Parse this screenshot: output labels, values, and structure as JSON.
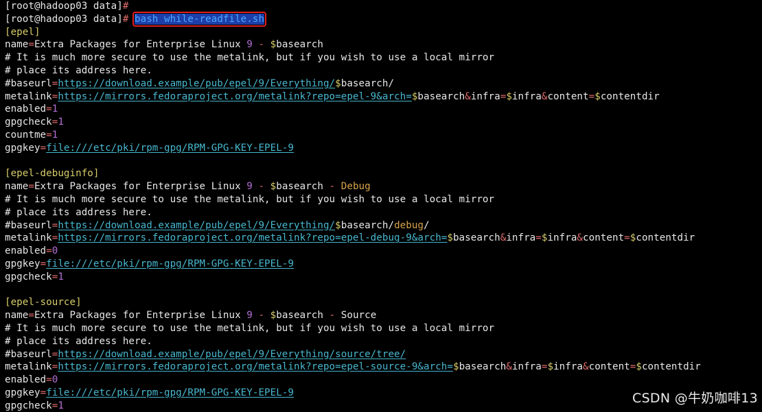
{
  "terminal": {
    "lines": [
      [
        {
          "t": "[root@hadoop03 data]",
          "c": "text"
        },
        {
          "t": "#",
          "c": "prompt-hash"
        }
      ],
      [
        {
          "t": "[root@hadoop03 data]",
          "c": "text"
        },
        {
          "t": "# ",
          "c": "prompt-hash"
        },
        {
          "t": "bash while-readfile.sh",
          "c": "cmd",
          "box": true
        }
      ],
      [
        {
          "t": "[epel]",
          "c": "sect"
        }
      ],
      [
        {
          "t": "name",
          "c": "text"
        },
        {
          "t": "=",
          "c": "op"
        },
        {
          "t": "Extra Packages for Enterprise Linux ",
          "c": "text"
        },
        {
          "t": "9",
          "c": "num"
        },
        {
          "t": " - ",
          "c": "op"
        },
        {
          "t": "$",
          "c": "dollar"
        },
        {
          "t": "basearch",
          "c": "text"
        }
      ],
      [
        {
          "t": "# It is much more secure to use the metalink, but if you wish to use a local mirror",
          "c": "text"
        }
      ],
      [
        {
          "t": "# place its address here.",
          "c": "text"
        }
      ],
      [
        {
          "t": "#baseurl",
          "c": "text"
        },
        {
          "t": "=",
          "c": "op"
        },
        {
          "t": "https://download.example/pub/epel/9/Everything/",
          "c": "link"
        },
        {
          "t": "$",
          "c": "dollar"
        },
        {
          "t": "basearch/",
          "c": "text"
        }
      ],
      [
        {
          "t": "metalink",
          "c": "text"
        },
        {
          "t": "=",
          "c": "op"
        },
        {
          "t": "https://mirrors.fedoraproject.org/metalink?repo=epel-9&arch=",
          "c": "link"
        },
        {
          "t": "$",
          "c": "dollar"
        },
        {
          "t": "basearch",
          "c": "text"
        },
        {
          "t": "&",
          "c": "op"
        },
        {
          "t": "infra",
          "c": "text"
        },
        {
          "t": "=",
          "c": "op"
        },
        {
          "t": "$",
          "c": "dollar"
        },
        {
          "t": "infra",
          "c": "text"
        },
        {
          "t": "&",
          "c": "op"
        },
        {
          "t": "content",
          "c": "text"
        },
        {
          "t": "=",
          "c": "op"
        },
        {
          "t": "$",
          "c": "dollar"
        },
        {
          "t": "contentdir",
          "c": "text"
        }
      ],
      [
        {
          "t": "enabled",
          "c": "text"
        },
        {
          "t": "=",
          "c": "op"
        },
        {
          "t": "1",
          "c": "num"
        }
      ],
      [
        {
          "t": "gpgcheck",
          "c": "text"
        },
        {
          "t": "=",
          "c": "op"
        },
        {
          "t": "1",
          "c": "num"
        }
      ],
      [
        {
          "t": "countme",
          "c": "text"
        },
        {
          "t": "=",
          "c": "op"
        },
        {
          "t": "1",
          "c": "num"
        }
      ],
      [
        {
          "t": "gpgkey",
          "c": "text"
        },
        {
          "t": "=",
          "c": "op"
        },
        {
          "t": "file:///etc/pki/rpm-gpg/RPM-GPG-KEY-EPEL-9",
          "c": "link"
        }
      ],
      [],
      [
        {
          "t": "[epel-debuginfo]",
          "c": "sect"
        }
      ],
      [
        {
          "t": "name",
          "c": "text"
        },
        {
          "t": "=",
          "c": "op"
        },
        {
          "t": "Extra Packages for Enterprise Linux ",
          "c": "text"
        },
        {
          "t": "9",
          "c": "num"
        },
        {
          "t": " - ",
          "c": "op"
        },
        {
          "t": "$",
          "c": "dollar"
        },
        {
          "t": "basearch",
          "c": "text"
        },
        {
          "t": " - ",
          "c": "op"
        },
        {
          "t": "Debug",
          "c": "kw"
        }
      ],
      [
        {
          "t": "# It is much more secure to use the metalink, but if you wish to use a local mirror",
          "c": "text"
        }
      ],
      [
        {
          "t": "# place its address here.",
          "c": "text"
        }
      ],
      [
        {
          "t": "#baseurl",
          "c": "text"
        },
        {
          "t": "=",
          "c": "op"
        },
        {
          "t": "https://download.example/pub/epel/9/Everything/",
          "c": "link"
        },
        {
          "t": "$",
          "c": "dollar"
        },
        {
          "t": "basearch/",
          "c": "text"
        },
        {
          "t": "debug",
          "c": "kw"
        },
        {
          "t": "/",
          "c": "text"
        }
      ],
      [
        {
          "t": "metalink",
          "c": "text"
        },
        {
          "t": "=",
          "c": "op"
        },
        {
          "t": "https://mirrors.fedoraproject.org/metalink?repo=epel-debug-9&arch=",
          "c": "link"
        },
        {
          "t": "$",
          "c": "dollar"
        },
        {
          "t": "basearch",
          "c": "text"
        },
        {
          "t": "&",
          "c": "op"
        },
        {
          "t": "infra",
          "c": "text"
        },
        {
          "t": "=",
          "c": "op"
        },
        {
          "t": "$",
          "c": "dollar"
        },
        {
          "t": "infra",
          "c": "text"
        },
        {
          "t": "&",
          "c": "op"
        },
        {
          "t": "content",
          "c": "text"
        },
        {
          "t": "=",
          "c": "op"
        },
        {
          "t": "$",
          "c": "dollar"
        },
        {
          "t": "contentdir",
          "c": "text"
        }
      ],
      [
        {
          "t": "enabled",
          "c": "text"
        },
        {
          "t": "=",
          "c": "op"
        },
        {
          "t": "0",
          "c": "num"
        }
      ],
      [
        {
          "t": "gpgkey",
          "c": "text"
        },
        {
          "t": "=",
          "c": "op"
        },
        {
          "t": "file:///etc/pki/rpm-gpg/RPM-GPG-KEY-EPEL-9",
          "c": "link"
        }
      ],
      [
        {
          "t": "gpgcheck",
          "c": "text"
        },
        {
          "t": "=",
          "c": "op"
        },
        {
          "t": "1",
          "c": "num"
        }
      ],
      [],
      [
        {
          "t": "[epel-source]",
          "c": "sect"
        }
      ],
      [
        {
          "t": "name",
          "c": "text"
        },
        {
          "t": "=",
          "c": "op"
        },
        {
          "t": "Extra Packages for Enterprise Linux ",
          "c": "text"
        },
        {
          "t": "9",
          "c": "num"
        },
        {
          "t": " - ",
          "c": "op"
        },
        {
          "t": "$",
          "c": "dollar"
        },
        {
          "t": "basearch",
          "c": "text"
        },
        {
          "t": " - ",
          "c": "op"
        },
        {
          "t": "Source",
          "c": "text"
        }
      ],
      [
        {
          "t": "# It is much more secure to use the metalink, but if you wish to use a local mirror",
          "c": "text"
        }
      ],
      [
        {
          "t": "# place its address here.",
          "c": "text"
        }
      ],
      [
        {
          "t": "#baseurl",
          "c": "text"
        },
        {
          "t": "=",
          "c": "op"
        },
        {
          "t": "https://download.example/pub/epel/9/Everything/source/tree/",
          "c": "link"
        }
      ],
      [
        {
          "t": "metalink",
          "c": "text"
        },
        {
          "t": "=",
          "c": "op"
        },
        {
          "t": "https://mirrors.fedoraproject.org/metalink?repo=epel-source-9&arch=",
          "c": "link"
        },
        {
          "t": "$",
          "c": "dollar"
        },
        {
          "t": "basearch",
          "c": "text"
        },
        {
          "t": "&",
          "c": "op"
        },
        {
          "t": "infra",
          "c": "text"
        },
        {
          "t": "=",
          "c": "op"
        },
        {
          "t": "$",
          "c": "dollar"
        },
        {
          "t": "infra",
          "c": "text"
        },
        {
          "t": "&",
          "c": "op"
        },
        {
          "t": "content",
          "c": "text"
        },
        {
          "t": "=",
          "c": "op"
        },
        {
          "t": "$",
          "c": "dollar"
        },
        {
          "t": "contentdir",
          "c": "text"
        }
      ],
      [
        {
          "t": "enabled",
          "c": "text"
        },
        {
          "t": "=",
          "c": "op"
        },
        {
          "t": "0",
          "c": "num"
        }
      ],
      [
        {
          "t": "gpgkey",
          "c": "text"
        },
        {
          "t": "=",
          "c": "op"
        },
        {
          "t": "file:///etc/pki/rpm-gpg/RPM-GPG-KEY-EPEL-9",
          "c": "link"
        }
      ],
      [
        {
          "t": "gpgcheck",
          "c": "text"
        },
        {
          "t": "=",
          "c": "op"
        },
        {
          "t": "1",
          "c": "num"
        }
      ]
    ]
  },
  "watermark": {
    "text": "CSDN @牛奶咖啡13"
  },
  "colors": {
    "background": "#000000",
    "text": "#e8e8e8",
    "section": "#d7cd6a",
    "operator": "#e06c6c",
    "number": "#b46fd6",
    "link": "#48b8d0",
    "command_bg": "#1d3ea8",
    "command_fg": "#4aa8ff",
    "keyword": "#d9a44a",
    "highlight_box": "#e01f1f"
  }
}
